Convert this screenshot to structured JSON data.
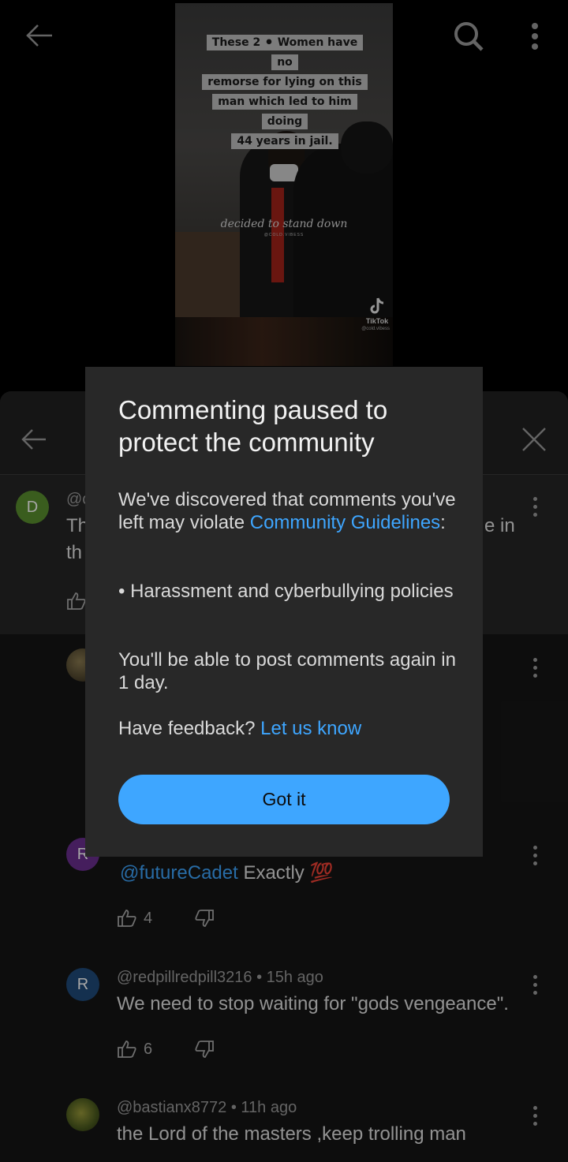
{
  "video": {
    "caption_lines": [
      "These 2 ⚫ Women have no",
      "remorse for lying on this",
      "man which led to him doing",
      "44 years in jail."
    ],
    "subtitle": "decided to stand down",
    "handle": "@COLD.VIBESS",
    "tiktok_label": "TikTok",
    "tiktok_handle": "@cold.vibess"
  },
  "comments": [
    {
      "avatar_letter": "D",
      "avatar_color": "#5a8f2e",
      "author_partial": "@c",
      "text_line1": "Th",
      "text_line2": "th",
      "text_right": "e in"
    },
    {
      "avatar_letter": "R",
      "avatar_color": "#6a2e8f",
      "mention": "@futureCadet",
      "text": " Exactly 💯",
      "likes": "4"
    },
    {
      "avatar_letter": "R",
      "avatar_color": "#1f4a7a",
      "meta": "@redpillredpill3216 • 15h ago",
      "text": "We need to stop waiting for \"gods vengeance\".",
      "likes": "6"
    },
    {
      "meta": "@bastianx8772 • 11h ago",
      "text": "the Lord of the masters ,keep trolling man"
    }
  ],
  "modal": {
    "title": "Commenting paused to protect the community",
    "body_prefix": "We've discovered that comments you've left may violate ",
    "body_link": "Community Guidelines",
    "body_suffix": ":",
    "policy": "• Harassment and cyberbullying policies",
    "resume_text": "You'll be able to post comments again in 1 day.",
    "feedback_prefix": "Have feedback? ",
    "feedback_link": "Let us know",
    "button_label": "Got it"
  },
  "colors": {
    "accent": "#3ea6ff",
    "sheet_bg": "#151515",
    "modal_bg": "#282828"
  }
}
